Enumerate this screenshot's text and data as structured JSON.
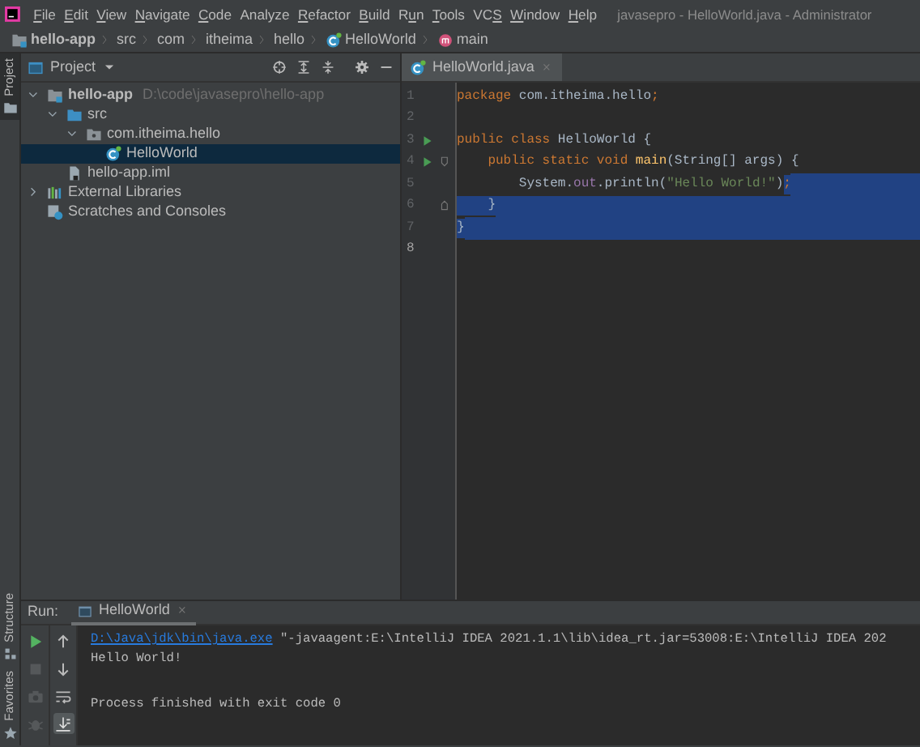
{
  "title_bar": {
    "menus": [
      {
        "parts": [
          {
            "text": "F",
            "underlined": true
          },
          {
            "text": "ile",
            "underlined": false
          }
        ]
      },
      {
        "parts": [
          {
            "text": "E",
            "underlined": true
          },
          {
            "text": "dit",
            "underlined": false
          }
        ]
      },
      {
        "parts": [
          {
            "text": "V",
            "underlined": true
          },
          {
            "text": "iew",
            "underlined": false
          }
        ]
      },
      {
        "parts": [
          {
            "text": "N",
            "underlined": true
          },
          {
            "text": "avigate",
            "underlined": false
          }
        ]
      },
      {
        "parts": [
          {
            "text": "C",
            "underlined": true
          },
          {
            "text": "ode",
            "underlined": false
          }
        ]
      },
      {
        "parts": [
          {
            "text": "Analyze",
            "underlined": false
          }
        ]
      },
      {
        "parts": [
          {
            "text": "R",
            "underlined": true
          },
          {
            "text": "efactor",
            "underlined": false
          }
        ]
      },
      {
        "parts": [
          {
            "text": "B",
            "underlined": true
          },
          {
            "text": "uild",
            "underlined": false
          }
        ]
      },
      {
        "parts": [
          {
            "text": "R",
            "underlined": false
          },
          {
            "text": "u",
            "underlined": true
          },
          {
            "text": "n",
            "underlined": false
          }
        ]
      },
      {
        "parts": [
          {
            "text": "T",
            "underlined": true
          },
          {
            "text": "ools",
            "underlined": false
          }
        ]
      },
      {
        "parts": [
          {
            "text": "VC",
            "underlined": false
          },
          {
            "text": "S",
            "underlined": true
          }
        ]
      },
      {
        "parts": [
          {
            "text": "W",
            "underlined": true
          },
          {
            "text": "indow",
            "underlined": false
          }
        ]
      },
      {
        "parts": [
          {
            "text": "H",
            "underlined": true
          },
          {
            "text": "elp",
            "underlined": false
          }
        ]
      }
    ],
    "title": "javasepro - HelloWorld.java - Administrator"
  },
  "breadcrumbs": [
    {
      "label": "hello-app",
      "kind": "module"
    },
    {
      "label": "src",
      "kind": "plain"
    },
    {
      "label": "com",
      "kind": "plain"
    },
    {
      "label": "itheima",
      "kind": "plain"
    },
    {
      "label": "hello",
      "kind": "plain"
    },
    {
      "label": "HelloWorld",
      "kind": "class"
    },
    {
      "label": "main",
      "kind": "method"
    }
  ],
  "tool_strip": {
    "top": [
      {
        "label": "Project",
        "kind": "project",
        "selected": true
      }
    ],
    "bottom": [
      {
        "label": "Structure",
        "kind": "structure",
        "selected": false
      },
      {
        "label": "Favorites",
        "kind": "favorites",
        "selected": false
      }
    ]
  },
  "project_panel": {
    "title": "Project",
    "tree": [
      {
        "label": "hello-app",
        "kind": "module",
        "path": "D:\\code\\javasepro\\hello-app",
        "expanded": true,
        "selected": false,
        "children": [
          {
            "label": "src",
            "kind": "folder",
            "expanded": true,
            "selected": false,
            "children": [
              {
                "label": "com.itheima.hello",
                "kind": "package",
                "expanded": true,
                "selected": false,
                "children": [
                  {
                    "label": "HelloWorld",
                    "kind": "class",
                    "selected": true
                  }
                ]
              }
            ]
          },
          {
            "label": "hello-app.iml",
            "kind": "file",
            "selected": false
          }
        ]
      },
      {
        "label": "External Libraries",
        "kind": "library",
        "expanded": false,
        "selected": false
      },
      {
        "label": "Scratches and Consoles",
        "kind": "scratches",
        "selected": false
      }
    ]
  },
  "editor": {
    "tabs": [
      {
        "label": "HelloWorld.java",
        "selected": true
      }
    ],
    "lines": [
      {
        "number": "1",
        "current": false,
        "run_marker": false,
        "fold_start": false,
        "fold_end": false,
        "selected_tail": false,
        "segments": [
          {
            "text": "package ",
            "kind": "keyword",
            "selected": false
          },
          {
            "text": "com.itheima.hello",
            "kind": "plain",
            "selected": false
          },
          {
            "text": ";",
            "kind": "keyword",
            "selected": false
          }
        ]
      },
      {
        "number": "2",
        "current": false,
        "run_marker": false,
        "fold_start": false,
        "fold_end": false,
        "selected_tail": false
      },
      {
        "number": "3",
        "current": false,
        "run_marker": true,
        "fold_start": false,
        "fold_end": false,
        "selected_tail": false,
        "segments": [
          {
            "text": "public class ",
            "kind": "keyword",
            "selected": false
          },
          {
            "text": "HelloWorld {",
            "kind": "plain",
            "selected": false
          }
        ]
      },
      {
        "number": "4",
        "current": false,
        "run_marker": true,
        "fold_start": true,
        "fold_end": false,
        "selected_tail": false,
        "segments": [
          {
            "text": "    public static void ",
            "kind": "keyword",
            "selected": false
          },
          {
            "text": "main",
            "kind": "method",
            "selected": false
          },
          {
            "text": "(String[] args) {",
            "kind": "plain",
            "selected": false
          }
        ]
      },
      {
        "number": "5",
        "current": false,
        "run_marker": false,
        "fold_start": false,
        "fold_end": false,
        "selected_tail": true,
        "segments": [
          {
            "text": "        System.",
            "kind": "plain",
            "selected": false
          },
          {
            "text": "out",
            "kind": "field",
            "selected": false
          },
          {
            "text": ".println(",
            "kind": "plain",
            "selected": false
          },
          {
            "text": "\"Hello World!\"",
            "kind": "string",
            "selected": false
          },
          {
            "text": ")",
            "kind": "plain",
            "selected": false
          },
          {
            "text": ";",
            "kind": "keyword",
            "selected": true
          }
        ]
      },
      {
        "number": "6",
        "current": false,
        "run_marker": false,
        "fold_start": false,
        "fold_end": true,
        "selected_tail": true,
        "segments": [
          {
            "text": "    }",
            "kind": "plain",
            "selected": true
          }
        ]
      },
      {
        "number": "7",
        "current": false,
        "run_marker": false,
        "fold_start": false,
        "fold_end": false,
        "selected_tail": true,
        "segments": [
          {
            "text": "}",
            "kind": "plain",
            "selected": true
          }
        ]
      },
      {
        "number": "8",
        "current": true,
        "run_marker": false,
        "fold_start": false,
        "fold_end": false,
        "selected_tail": false
      }
    ]
  },
  "run_panel": {
    "label": "Run:",
    "tabs": [
      {
        "label": "HelloWorld",
        "selected": true
      }
    ],
    "toolbar_left": [
      {
        "kind": "run",
        "disabled": false
      },
      {
        "kind": "stop",
        "disabled": true
      },
      {
        "kind": "camera",
        "disabled": true
      },
      {
        "kind": "bug",
        "disabled": true
      }
    ],
    "toolbar_right": [
      {
        "kind": "up",
        "selected": false
      },
      {
        "kind": "down",
        "selected": false
      },
      {
        "kind": "wrap",
        "selected": false
      },
      {
        "kind": "scroll-end",
        "selected": true
      }
    ],
    "console": [
      {
        "kind": "command",
        "segments": [
          {
            "text": "D:\\Java\\jdk\\bin\\java.exe",
            "kind": "link"
          },
          {
            "text": " \"-javaagent:E:\\IntelliJ IDEA 2021.1.1\\lib\\idea_rt.jar=53008:E:\\IntelliJ IDEA 202",
            "kind": "plain"
          }
        ]
      },
      {
        "kind": "output",
        "segments": [
          {
            "text": "Hello World!",
            "kind": "plain"
          }
        ]
      },
      {
        "kind": "status",
        "segments": [
          {
            "text": "Process finished with exit code 0",
            "kind": "plain"
          }
        ]
      }
    ]
  }
}
